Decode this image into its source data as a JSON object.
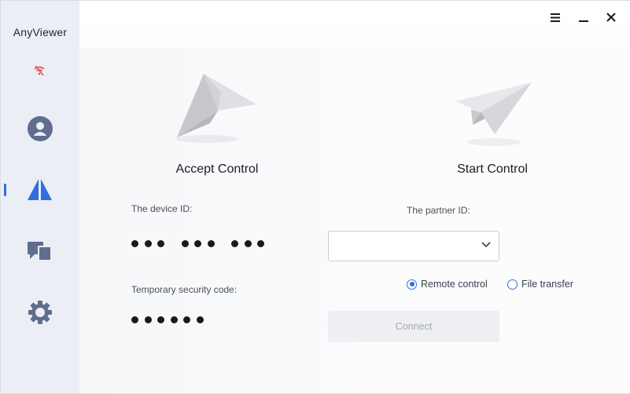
{
  "app": {
    "title": "AnyViewer"
  },
  "sidebar": {
    "items": [
      {
        "name": "account",
        "icon": "user-icon"
      },
      {
        "name": "connect",
        "icon": "connect-logo-icon",
        "active": true
      },
      {
        "name": "devices",
        "icon": "devices-icon"
      },
      {
        "name": "settings",
        "icon": "gear-icon"
      }
    ],
    "network_status_icon": "no-network-icon"
  },
  "window_controls": [
    "menu-icon",
    "minimize-icon",
    "close-icon"
  ],
  "accept": {
    "heading": "Accept Control",
    "device_id_label": "The device ID:",
    "security_code_label": "Temporary security code:"
  },
  "start": {
    "heading": "Start Control",
    "partner_id_label": "The partner ID:",
    "partner_id_value": "",
    "options": [
      {
        "label": "Remote control",
        "selected": true
      },
      {
        "label": "File transfer",
        "selected": false
      }
    ],
    "connect_label": "Connect"
  },
  "colors": {
    "accent": "#2f6fde",
    "sidebar_bg": "#eceef5",
    "icon": "#5f6d8f",
    "warning": "#e05454"
  }
}
